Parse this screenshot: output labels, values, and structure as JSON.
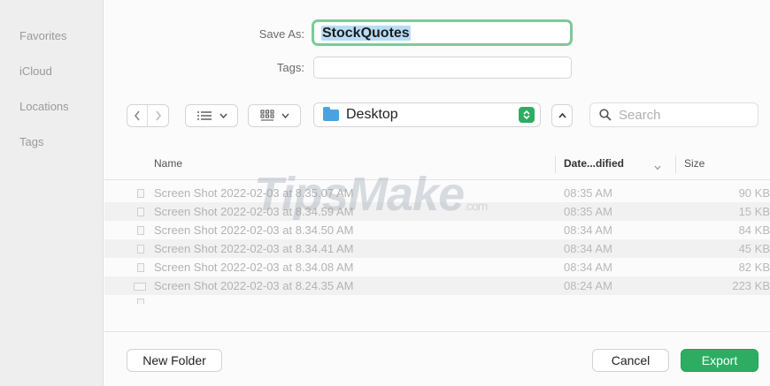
{
  "sidebar": {
    "items": [
      {
        "label": "Favorites"
      },
      {
        "label": "iCloud"
      },
      {
        "label": "Locations"
      },
      {
        "label": "Tags"
      }
    ]
  },
  "form": {
    "save_as_label": "Save As:",
    "save_as_value": "StockQuotes",
    "tags_label": "Tags:"
  },
  "toolbar": {
    "back_icon": "chevron-left-icon",
    "forward_icon": "chevron-right-icon",
    "list_view_icon": "list-view-icon",
    "icon_view_icon": "icon-grid-icon",
    "location": "Desktop",
    "expand_icon": "chevron-up-icon",
    "search_placeholder": "Search"
  },
  "columns": {
    "name": "Name",
    "date": "Date...dified",
    "size": "Size"
  },
  "files": [
    {
      "name": "Screen Shot 2022-02-03 at 8.35.07 AM",
      "date": "08:35 AM",
      "size": "90 KB"
    },
    {
      "name": "Screen Shot 2022-02-03 at 8.34.59 AM",
      "date": "08:35 AM",
      "size": "15 KB"
    },
    {
      "name": "Screen Shot 2022-02-03 at 8.34.50 AM",
      "date": "08:34 AM",
      "size": "84 KB"
    },
    {
      "name": "Screen Shot 2022-02-03 at 8.34.41 AM",
      "date": "08:34 AM",
      "size": "45 KB"
    },
    {
      "name": "Screen Shot 2022-02-03 at 8.34.08 AM",
      "date": "08:34 AM",
      "size": "82 KB"
    },
    {
      "name": "Screen Shot 2022-02-03 at 8.24.35 AM",
      "date": "08:24 AM",
      "size": "223 KB"
    }
  ],
  "watermark": {
    "text": "TipsMake",
    "suffix": ".com"
  },
  "footer": {
    "new_folder": "New Folder",
    "cancel": "Cancel",
    "export": "Export"
  },
  "colors": {
    "accent": "#2ead62",
    "focus_ring": "#7fc89a",
    "selection": "#b9dcf5"
  }
}
